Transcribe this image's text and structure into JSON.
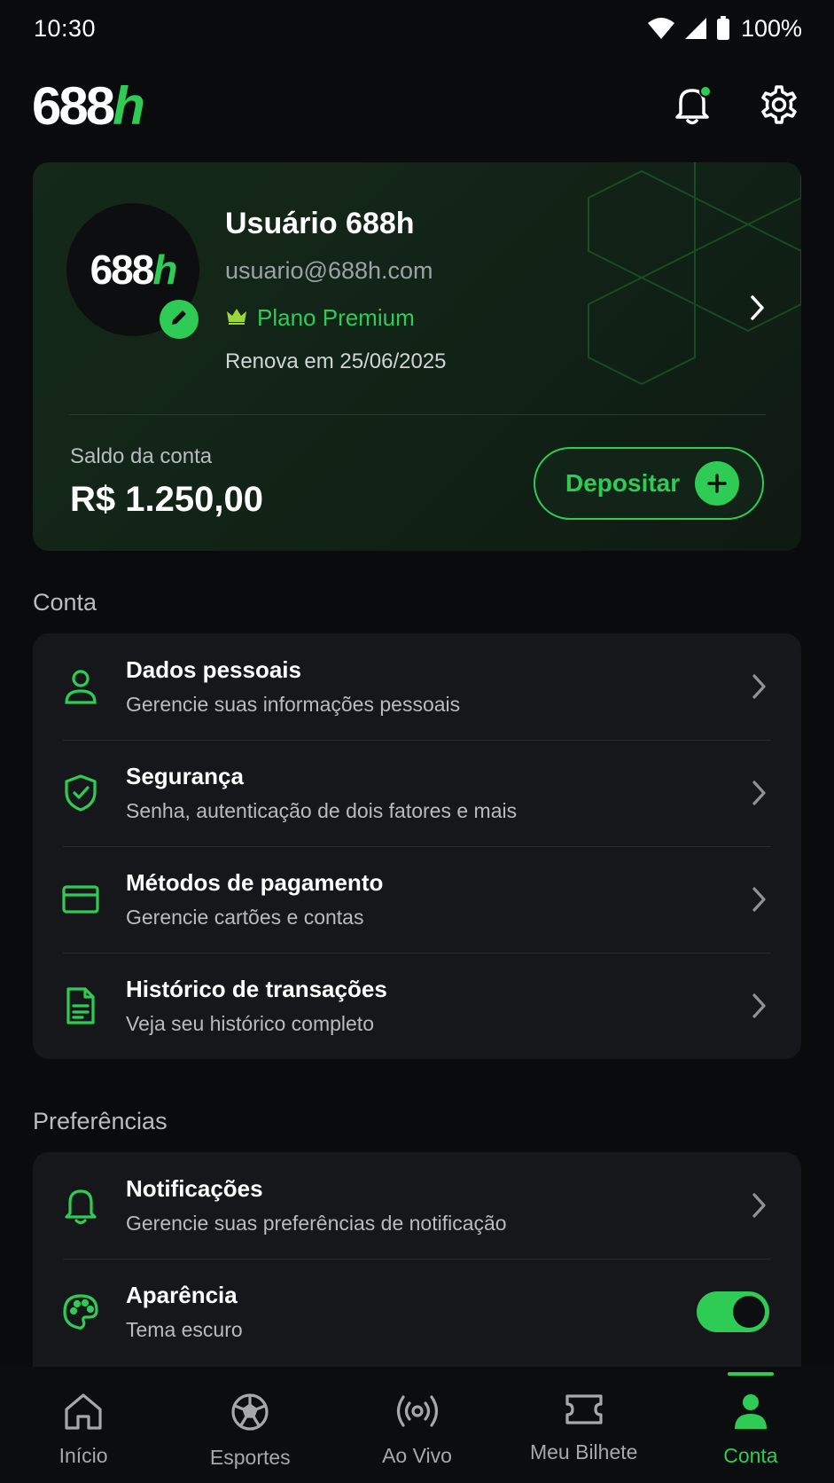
{
  "status_bar": {
    "time": "10:30",
    "battery": "100%"
  },
  "header": {
    "logo_number": "688",
    "logo_letter": "h"
  },
  "profile": {
    "avatar_number": "688",
    "avatar_letter": "h",
    "name": "Usuário 688h",
    "email": "usuario@688h.com",
    "plan": "Plano Premium",
    "renewal": "Renova em 25/06/2025",
    "balance_label": "Saldo da conta",
    "balance_value": "R$ 1.250,00",
    "deposit_label": "Depositar"
  },
  "sections": {
    "account_title": "Conta",
    "preferences_title": "Preferências"
  },
  "account_items": [
    {
      "title": "Dados pessoais",
      "subtitle": "Gerencie suas informações pessoais",
      "icon": "user-icon"
    },
    {
      "title": "Segurança",
      "subtitle": "Senha, autenticação de dois fatores e mais",
      "icon": "shield-check-icon"
    },
    {
      "title": "Métodos de pagamento",
      "subtitle": "Gerencie cartões e contas",
      "icon": "credit-card-icon"
    },
    {
      "title": "Histórico de transações",
      "subtitle": "Veja seu histórico completo",
      "icon": "document-icon"
    }
  ],
  "preference_items": [
    {
      "title": "Notificações",
      "subtitle": "Gerencie suas preferências de notificação",
      "icon": "bell-icon"
    },
    {
      "title": "Aparência",
      "subtitle": "Tema escuro",
      "icon": "palette-icon",
      "toggle_on": true
    }
  ],
  "bottom_nav": [
    {
      "label": "Início",
      "icon": "home-icon",
      "active": false
    },
    {
      "label": "Esportes",
      "icon": "soccer-ball-icon",
      "active": false
    },
    {
      "label": "Ao Vivo",
      "icon": "live-broadcast-icon",
      "active": false
    },
    {
      "label": "Meu Bilhete",
      "icon": "ticket-icon",
      "active": false
    },
    {
      "label": "Conta",
      "icon": "person-icon",
      "active": true
    }
  ],
  "colors": {
    "accent": "#2ecc55",
    "background": "#0a0b0c",
    "card": "#15171a"
  }
}
